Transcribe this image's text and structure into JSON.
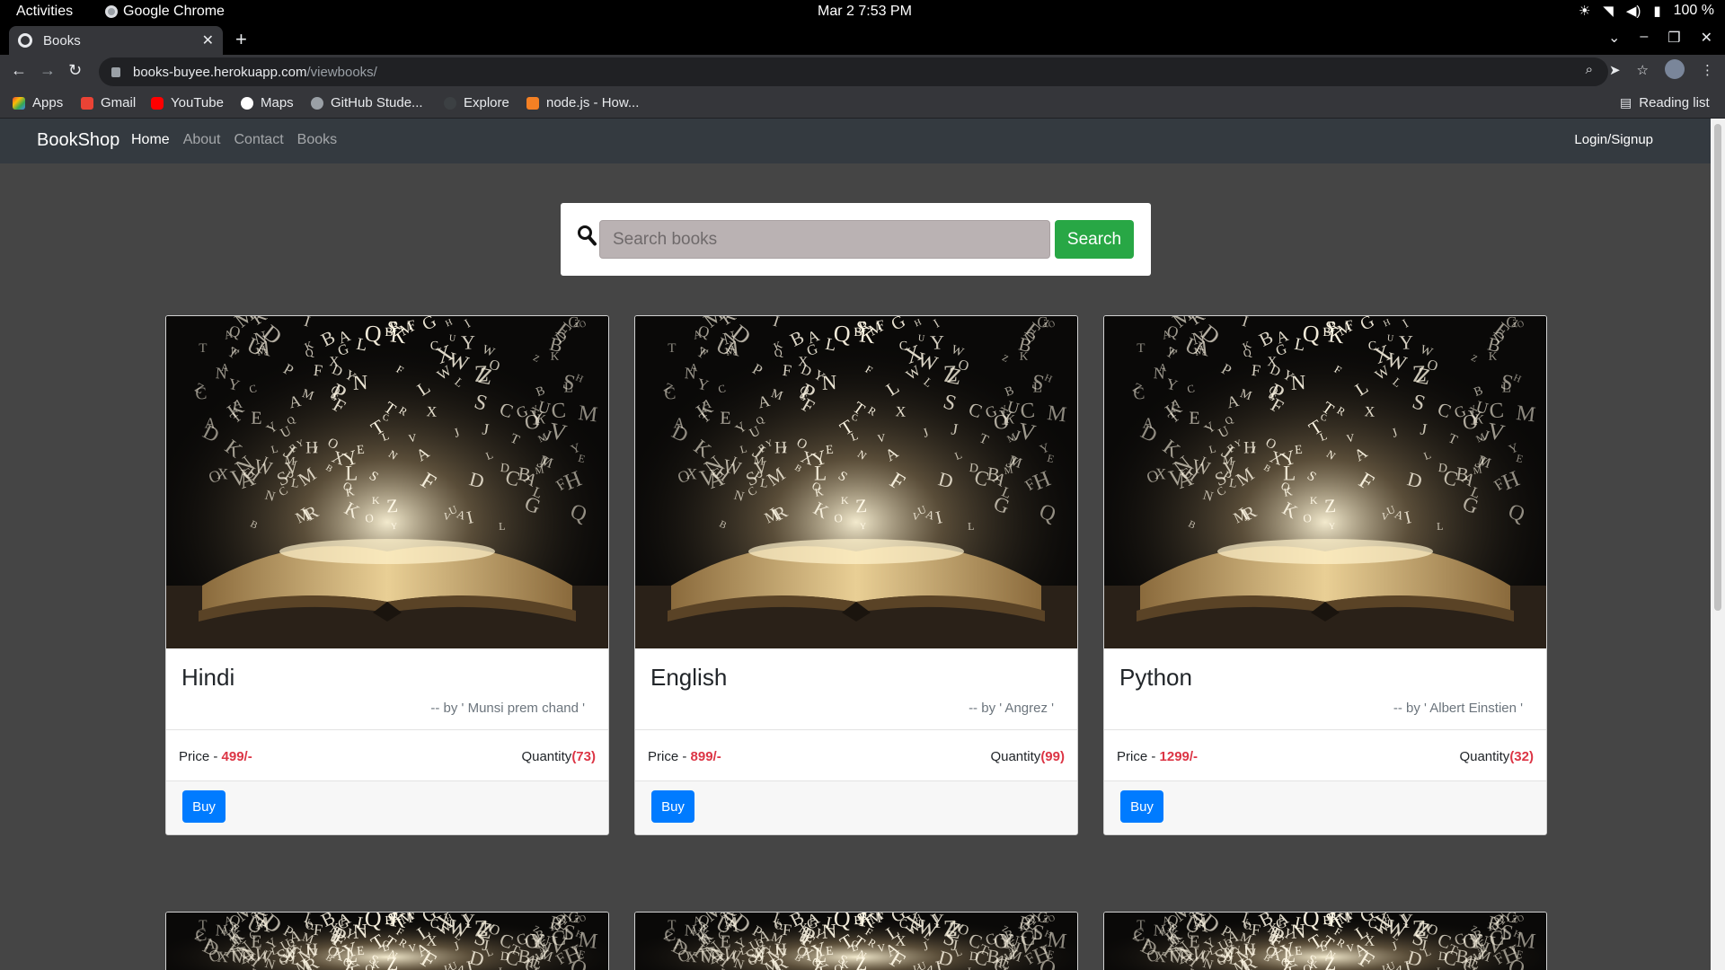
{
  "os": {
    "activities": "Activities",
    "app_name": "Google Chrome",
    "clock": "Mar 2  7:53 PM",
    "battery": "100 %"
  },
  "browser": {
    "tab_title": "Books",
    "url_host": "books-buyee.herokuapp.com",
    "url_path": "/viewbooks/",
    "bookmarks": [
      "Apps",
      "Gmail",
      "YouTube",
      "Maps",
      "GitHub Stude...",
      "Explore",
      "node.js - How..."
    ],
    "reading_list": "Reading list"
  },
  "site": {
    "brand": "BookShop",
    "nav": [
      "Home",
      "About",
      "Contact",
      "Books"
    ],
    "login": "Login/Signup",
    "search_placeholder": "Search books",
    "search_button": "Search"
  },
  "books": [
    {
      "title": "Hindi",
      "author": "-- by ' Munsi prem chand '",
      "price_label": "Price - ",
      "price": "499/-",
      "qty_label": "Quantity",
      "qty": "(73)",
      "buy": "Buy"
    },
    {
      "title": "English",
      "author": "-- by ' Angrez '",
      "price_label": "Price - ",
      "price": "899/-",
      "qty_label": "Quantity",
      "qty": "(99)",
      "buy": "Buy"
    },
    {
      "title": "Python",
      "author": "-- by ' Albert Einstien '",
      "price_label": "Price - ",
      "price": "1299/-",
      "qty_label": "Quantity",
      "qty": "(32)",
      "buy": "Buy"
    }
  ],
  "colors": {
    "navbar": "#343a40",
    "search_green": "#28a745",
    "buy_blue": "#007bff",
    "price_red": "#dc3545"
  }
}
